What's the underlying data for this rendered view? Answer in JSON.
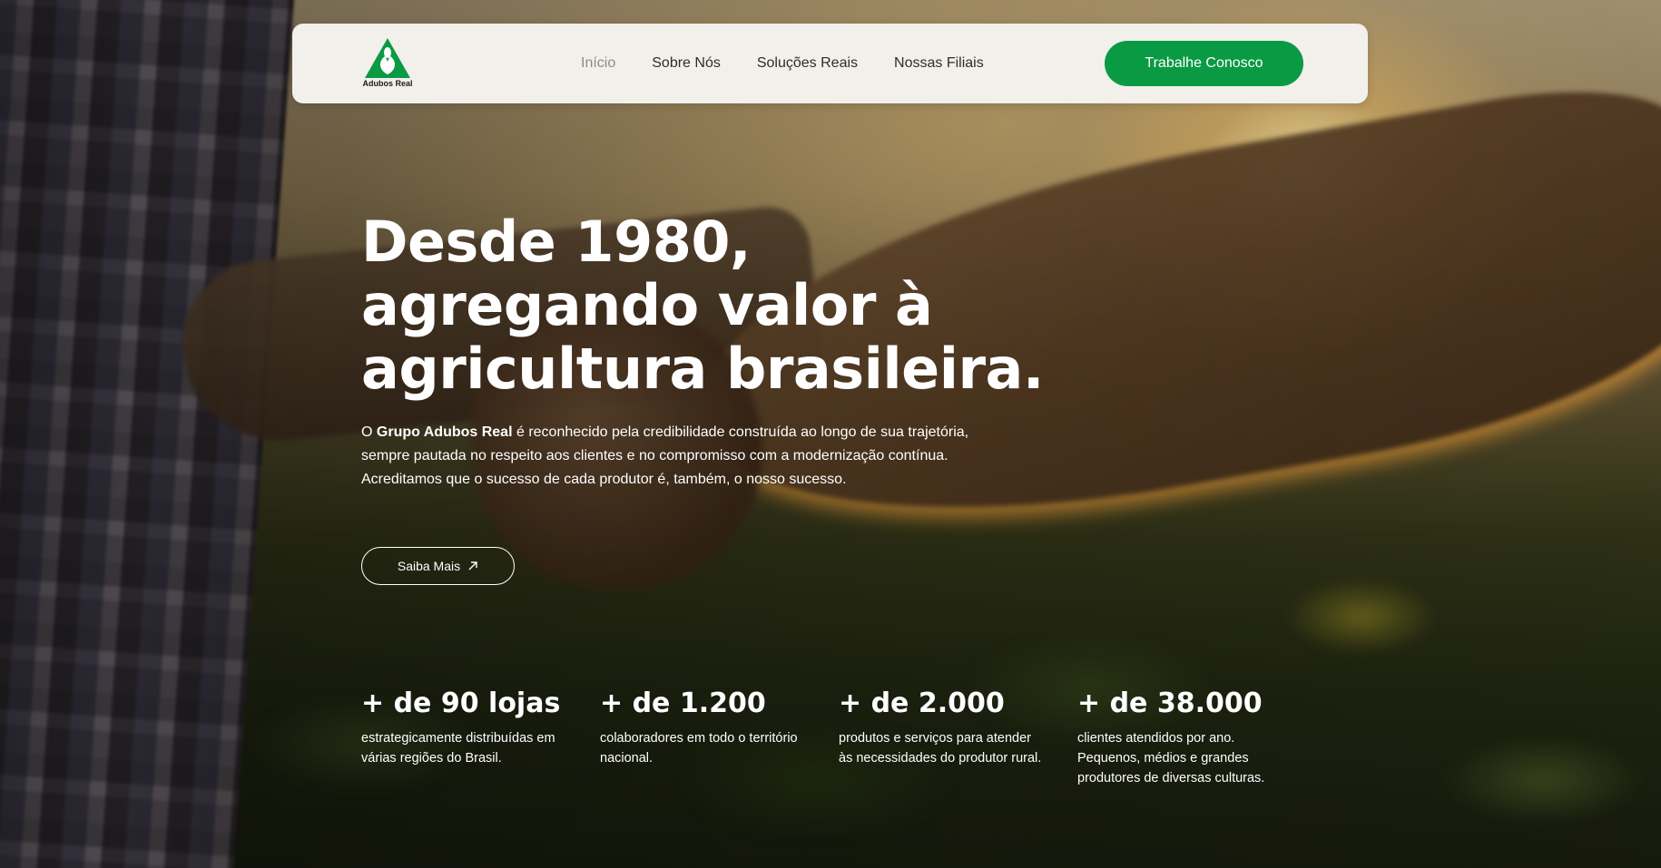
{
  "brand": {
    "name": "Adubos Real",
    "accent_color": "#0b9a44",
    "logo_icon": "leaf-logo-icon"
  },
  "nav": {
    "items": [
      {
        "label": "Início",
        "active": true
      },
      {
        "label": "Sobre Nós",
        "active": false
      },
      {
        "label": "Soluções Reais",
        "active": false
      },
      {
        "label": "Nossas Filiais",
        "active": false
      }
    ],
    "cta_label": "Trabalhe Conosco"
  },
  "hero": {
    "headline_lines": [
      "Desde 1980,",
      "agregando valor à",
      "agricultura brasileira."
    ],
    "intro_prefix": "O ",
    "intro_bold": "Grupo Adubos Real",
    "intro_rest": " é reconhecido pela credibilidade construída ao longo de sua trajetória, sempre pautada no respeito aos clientes e no compromisso com a modernização contínua. Acreditamos que o sucesso de cada produtor é, também, o nosso sucesso.",
    "button_label": "Saiba Mais",
    "button_icon": "arrow-up-right-icon"
  },
  "stats": [
    {
      "value": "+ de 90 lojas",
      "desc": "estrategicamente distribuídas em várias regiões do Brasil."
    },
    {
      "value": "+ de 1.200",
      "desc": "colaboradores em todo o território nacional."
    },
    {
      "value": "+ de 2.000",
      "desc": "produtos e serviços para atender às necessidades do produtor rural."
    },
    {
      "value": "+ de 38.000",
      "desc": "clientes atendidos por ano. Pequenos, médios e grandes produtores de diversas culturas."
    }
  ]
}
